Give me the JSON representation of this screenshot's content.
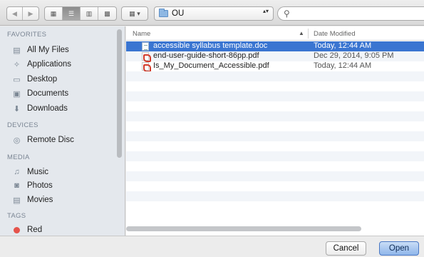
{
  "toolbar": {
    "back_glyph": "◀",
    "forward_glyph": "▶",
    "view_glyphs": [
      "▦",
      "☰",
      "▥",
      "▩"
    ],
    "arrange_glyph": "▦ ▾",
    "location": "OU",
    "location_updown": "▴▾",
    "search_glyph": "⚲",
    "search_value": ""
  },
  "sidebar": {
    "favorites_header": "FAVORITES",
    "favorites": [
      {
        "label": "All My Files",
        "icon": "all-files-icon",
        "glyph": "▤"
      },
      {
        "label": "Applications",
        "icon": "applications-icon",
        "glyph": "✧"
      },
      {
        "label": "Desktop",
        "icon": "desktop-icon",
        "glyph": "▭"
      },
      {
        "label": "Documents",
        "icon": "documents-icon",
        "glyph": "▣"
      },
      {
        "label": "Downloads",
        "icon": "downloads-icon",
        "glyph": "⬇"
      }
    ],
    "devices_header": "DEVICES",
    "devices": [
      {
        "label": "Remote Disc",
        "icon": "disc-icon",
        "glyph": "◎"
      }
    ],
    "media_header": "MEDIA",
    "media": [
      {
        "label": "Music",
        "icon": "music-icon",
        "glyph": "♫"
      },
      {
        "label": "Photos",
        "icon": "camera-icon",
        "glyph": "◙"
      },
      {
        "label": "Movies",
        "icon": "film-icon",
        "glyph": "▤"
      }
    ],
    "tags_header": "TAGS",
    "tags": [
      {
        "label": "Red",
        "color": "#e5534b"
      }
    ]
  },
  "filelist": {
    "col_name": "Name",
    "col_date": "Date Modified",
    "sort_glyph": "▲",
    "files": [
      {
        "name": "accessible syllabus template.doc",
        "date": "Today, 12:44 AM",
        "type": "doc",
        "selected": true
      },
      {
        "name": "end-user-guide-short-86pp.pdf",
        "date": "Dec 29, 2014, 9:05 PM",
        "type": "pdf",
        "selected": false
      },
      {
        "name": "Is_My_Document_Accessible.pdf",
        "date": "Today, 12:44 AM",
        "type": "pdf",
        "selected": false
      }
    ],
    "empty_rows": 14
  },
  "buttons": {
    "cancel": "Cancel",
    "open": "Open"
  },
  "colors": {
    "selection": "#3a75d1",
    "sidebar_bg": "#e4e8ed",
    "open_button": "#8fb6ea"
  }
}
